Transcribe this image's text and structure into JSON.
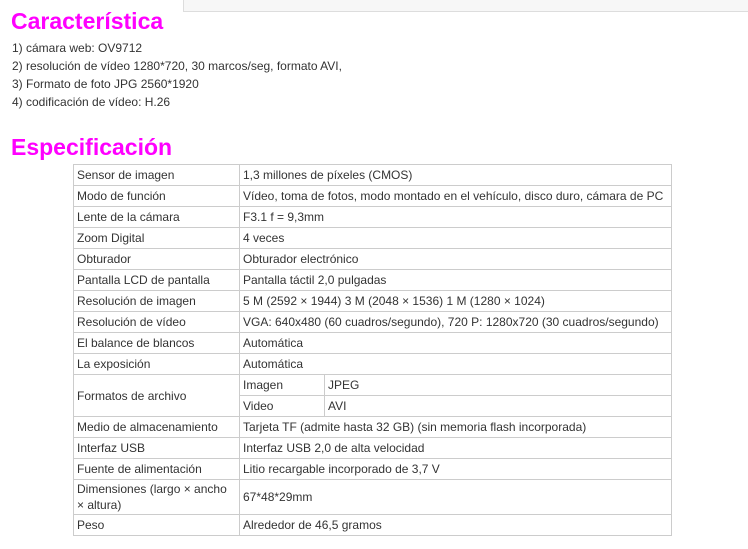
{
  "features": {
    "title": "Característica",
    "items": [
      "1) cámara web: OV9712",
      "2) resolución de vídeo 1280*720, 30 marcos/seg, formato AVI,",
      "3) Formato de foto JPG 2560*1920",
      "4) codificación de vídeo: H.26"
    ]
  },
  "spec": {
    "title": "Especificación",
    "rows": [
      {
        "key": "Sensor de imagen",
        "value": "1,3 millones de píxeles (CMOS)"
      },
      {
        "key": "Modo de función",
        "value": "Vídeo, toma de fotos, modo montado en el vehículo, disco duro, cámara de PC"
      },
      {
        "key": "Lente de la cámara",
        "value": "F3.1 f = 9,3mm"
      },
      {
        "key": "Zoom Digital",
        "value": "4 veces"
      },
      {
        "key": "Obturador",
        "value": "Obturador electrónico"
      },
      {
        "key": "Pantalla LCD de pantalla",
        "value": "Pantalla táctil 2,0 pulgadas"
      },
      {
        "key": "Resolución de imagen",
        "value": "5 M (2592 × 1944) 3 M (2048 × 1536) 1 M (1280 × 1024)"
      },
      {
        "key": "Resolución de vídeo",
        "value": "VGA: 640x480 (60 cuadros/segundo), 720 P: 1280x720 (30 cuadros/segundo)"
      },
      {
        "key": "El balance de blancos",
        "value": "Automática"
      },
      {
        "key": "La exposición",
        "value": "Automática"
      },
      {
        "key": "Formatos de archivo",
        "subrows": [
          {
            "label": "Imagen",
            "value": "JPEG"
          },
          {
            "label": "Video",
            "value": "AVI"
          }
        ]
      },
      {
        "key": "Medio de almacenamiento",
        "value": "Tarjeta TF (admite hasta 32 GB) (sin memoria flash incorporada)"
      },
      {
        "key": "Interfaz USB",
        "value": "Interfaz USB 2,0 de alta velocidad"
      },
      {
        "key": "Fuente de alimentación",
        "value": "Litio recargable incorporado de 3,7 V"
      },
      {
        "key": "Dimensiones (largo × ancho × altura)",
        "value": "67*48*29mm"
      },
      {
        "key": "Peso",
        "value": "Alrededor de 46,5 gramos"
      }
    ]
  },
  "colors": {
    "heading": "#ff00ff",
    "text": "#333333",
    "border": "#cccccc"
  }
}
